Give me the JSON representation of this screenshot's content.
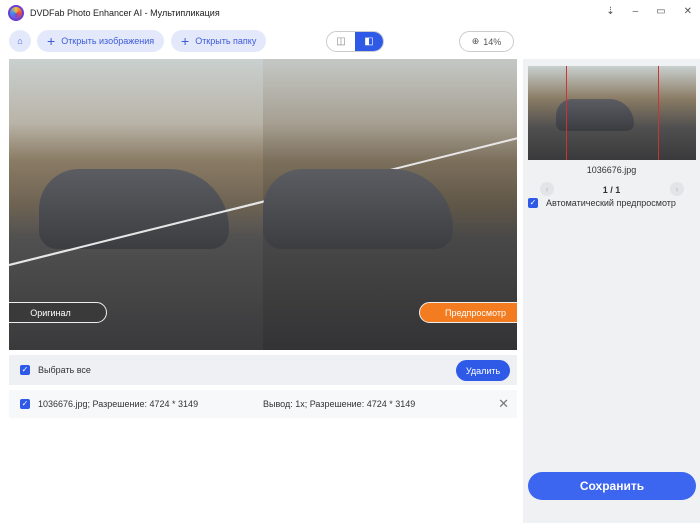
{
  "window": {
    "title": "DVDFab Photo Enhancer AI - Мультипликация"
  },
  "toolbar": {
    "open_images": "Открыть изображения",
    "open_folder": "Открыть папку",
    "zoom": "14%"
  },
  "preview": {
    "original_label": "Оригинал",
    "preview_label": "Предпросмотр"
  },
  "list": {
    "select_all": "Выбрать все",
    "delete": "Удалить",
    "items": [
      {
        "name": "1036676.jpg; Разрешение: 4724 * 3149",
        "output": "Вывод: 1x; Разрешение: 4724 * 3149"
      }
    ]
  },
  "sidebar": {
    "filename": "1036676.jpg",
    "page": "1 / 1",
    "auto_preview": "Автоматический предпросмотр",
    "save": "Сохранить"
  }
}
